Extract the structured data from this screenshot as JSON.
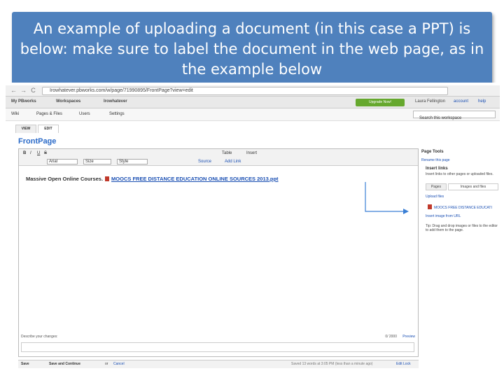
{
  "banner": {
    "title": "An example of uploading a document  (in this case a PPT) is below: make sure to label the document in the web page, as in the example below"
  },
  "browser": {
    "url": "Irowhatever.pbworks.com/w/page/71990895/FrontPage?view=edit",
    "back_glyph": "←",
    "forward_glyph": "→",
    "reload_glyph": "C"
  },
  "app": {
    "nav": {
      "my_pbworks": "My PBworks",
      "workspaces": "Workspaces",
      "workspace_name": "Irowhatever",
      "upgrade": "Upgrade Now!",
      "user": "Laura Fellington",
      "account": "account",
      "help": "help"
    },
    "subnav": {
      "wiki": "Wiki",
      "pages_files": "Pages & Files",
      "users": "Users",
      "settings": "Settings",
      "search_placeholder": "Search this workspace"
    },
    "tabs": {
      "view": "VIEW",
      "edit": "EDIT"
    },
    "page_title": "FrontPage",
    "editor": {
      "toolbar": {
        "bold": "B",
        "italic": "I",
        "underline": "U",
        "strike": "S",
        "table": "Table",
        "insert": "Insert",
        "font": "Arial",
        "size": "Size",
        "style": "Style",
        "source": "Source",
        "add_link": "Add Link"
      },
      "content": {
        "text": "Massive Open Online Courses.",
        "doc_link": "MOOCS FREE DISTANCE EDUCATION ONLINE SOURCES 2013.ppt"
      },
      "describe_changes": "Describe your changes:",
      "char_count": "0/ 2000",
      "preview": "Preview"
    },
    "bottom": {
      "save": "Save",
      "save_continue": "Save and Continue",
      "or": "or",
      "cancel": "Cancel",
      "saved_status": "Saved 13 words at 3:05 PM (less than a minute ago)",
      "edit_lock": "Edit Lock"
    },
    "sidepanel": {
      "page_tools": "Page Tools",
      "rename": "Rename this page",
      "insert_links": "Insert links",
      "insert_links_desc": "Insert links to other pages or uploaded files.",
      "tab_pages": "Pages",
      "tab_images_files": "Images and files",
      "upload_files": "Upload files",
      "file_name": "MOOCS FREE DISTANCE EDUCATI",
      "insert_image_url": "Insert image from URL",
      "tip": "Tip: Drag and drop images or files to the editor to add them to the page."
    }
  },
  "colors": {
    "banner_bg": "#4f81bd",
    "link_blue": "#1a4fb3",
    "arrow": "#3a7fd5",
    "upgrade_green": "#66a82e"
  }
}
